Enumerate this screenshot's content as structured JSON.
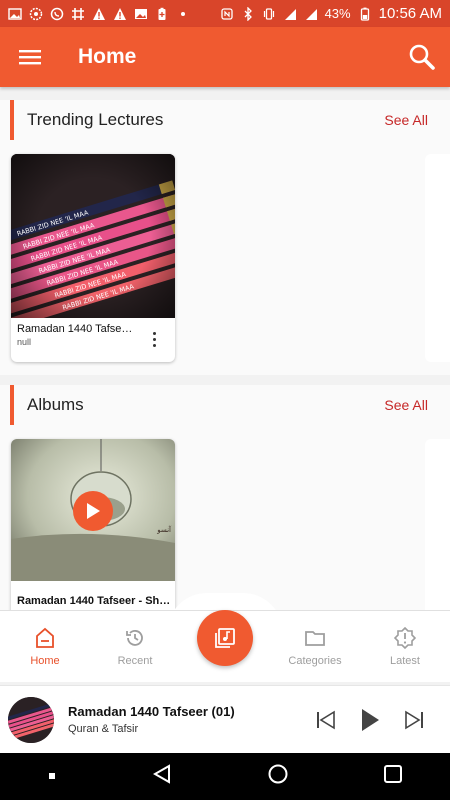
{
  "status_bar": {
    "battery": "43%",
    "time": "10:56 AM",
    "left_icons": [
      "image-icon",
      "settings-icon",
      "whatsapp-icon",
      "grid-icon",
      "warning-icon",
      "warning-icon",
      "image-icon",
      "battery-saver-icon",
      "dot-icon"
    ],
    "right_icons": [
      "nfc-icon",
      "bluetooth-icon",
      "vibrate-icon",
      "lte-signal-icon",
      "signal-icon",
      "battery-icon"
    ]
  },
  "app_bar": {
    "title": "Home",
    "menu_icon": "hamburger-menu-icon",
    "search_icon": "search-icon"
  },
  "sections": [
    {
      "title": "Trending Lectures",
      "see_all": "See All",
      "cards": [
        {
          "title": "Ramadan 1440 Tafse…",
          "subtitle": "null",
          "image_text": "RABBI ZID NEE 'IL MAA"
        }
      ]
    },
    {
      "title": "Albums",
      "see_all": "See All",
      "cards": [
        {
          "title": "Ramadan 1440 Tafseer - Sh…",
          "image_text": "آنسو"
        }
      ]
    }
  ],
  "bottom_nav": {
    "items": [
      {
        "label": "Home",
        "icon": "home-icon",
        "active": true
      },
      {
        "label": "Recent",
        "icon": "history-icon",
        "active": false
      },
      {
        "label": "Categories",
        "icon": "folder-icon",
        "active": false
      },
      {
        "label": "Latest",
        "icon": "new-badge-icon",
        "active": false
      }
    ],
    "center_icon": "music-library-icon"
  },
  "mini_player": {
    "title": "Ramadan 1440 Tafseer (01)",
    "subtitle": "Quran & Tafsir",
    "controls": [
      "skip-previous-icon",
      "play-icon",
      "skip-next-icon"
    ]
  },
  "colors": {
    "primary": "#f05a30",
    "status_bar": "#d9452a",
    "see_all": "#c62828",
    "active_nav": "#e8502a"
  }
}
